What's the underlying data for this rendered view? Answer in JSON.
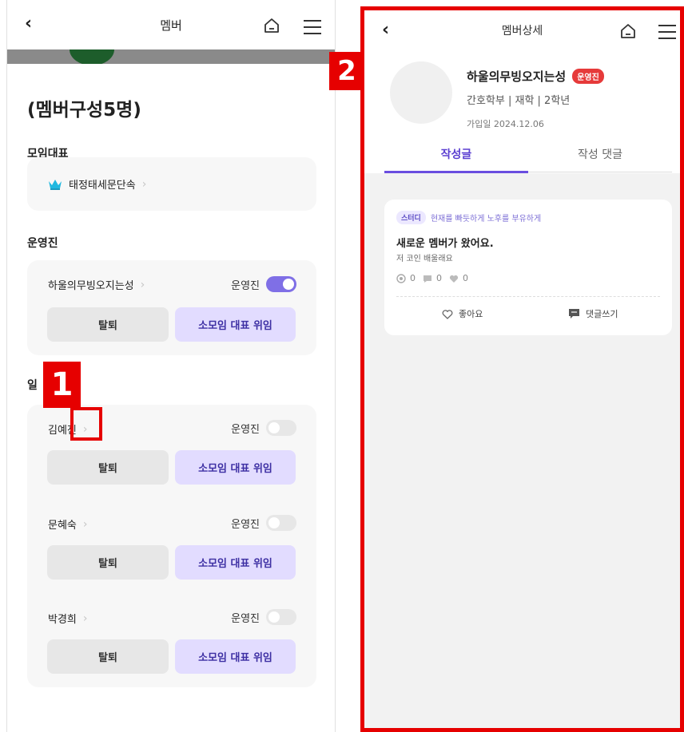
{
  "left": {
    "nav_title": "멤버",
    "heading": "(멤버구성5명)",
    "leader_section": "모임대표",
    "leader_name": "태정태세문단속",
    "staff_section": "운영진",
    "general_section_visible": "일",
    "role_label": "운영진",
    "withdraw_label": "탈퇴",
    "delegate_label": "소모임 대표 위임",
    "staff": [
      {
        "name": "하울의무빙오지는성",
        "role_on": true
      }
    ],
    "members": [
      {
        "name": "김예진",
        "role_on": false
      },
      {
        "name": "문혜숙",
        "role_on": false
      },
      {
        "name": "박경희",
        "role_on": false
      }
    ]
  },
  "annotations": {
    "badge1": "1",
    "badge2": "2"
  },
  "right": {
    "nav_title": "멤버상세",
    "profile": {
      "name": "하울의무빙오지는성",
      "role_badge": "운영진",
      "info": "간호학부 | 재학 | 2학년",
      "joined": "가입일 2024.12.06"
    },
    "tabs": [
      {
        "label": "작성글",
        "active": true
      },
      {
        "label": "작성 댓글",
        "active": false
      }
    ],
    "post": {
      "category": "스터디",
      "group_name": "현재를 빠듯하게 노후를 부유하게",
      "title": "새로운 멤버가 왔어요.",
      "body": "저 코인 배울래요",
      "views": "0",
      "comments": "0",
      "likes": "0",
      "like_label": "좋아요",
      "comment_label": "댓글쓰기"
    }
  },
  "colors": {
    "accent": "#7f6fe6",
    "annotation_red": "#e60000",
    "role_badge": "#e63a3a"
  }
}
